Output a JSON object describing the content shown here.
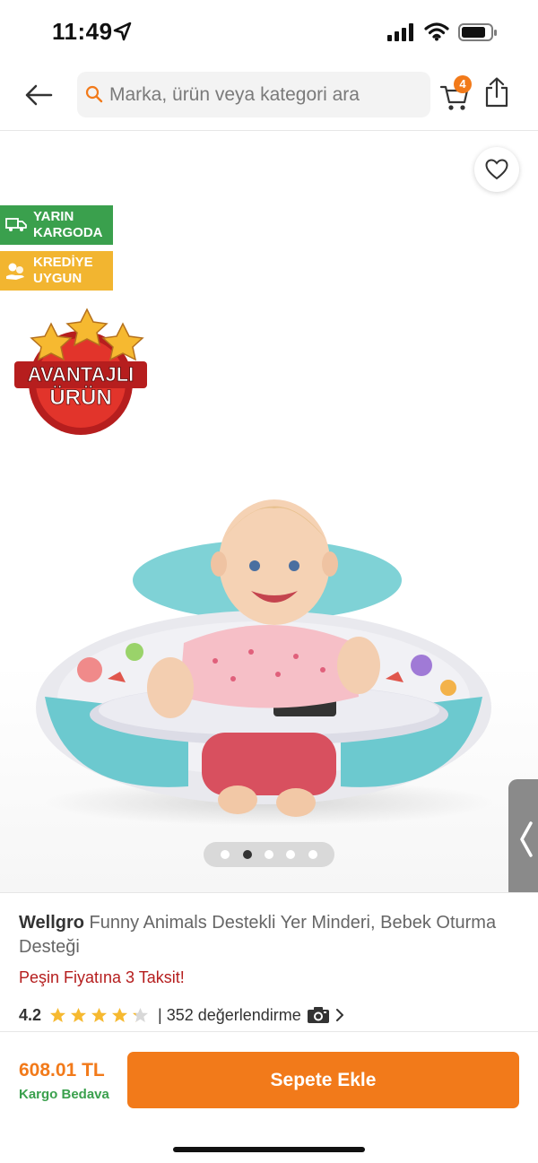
{
  "status_bar": {
    "time": "11:49",
    "icons": [
      "location-arrow-icon",
      "signal-icon",
      "wifi-icon",
      "battery-icon"
    ]
  },
  "header": {
    "back_icon": "arrow-left-icon",
    "search_placeholder": "Marka, ürün veya kategori ara",
    "cart_count": "4",
    "share_icon": "share-icon"
  },
  "product_image": {
    "tags": [
      {
        "label": "YARIN\nKARGODA",
        "icon": "truck-icon",
        "color": "#3aa04d"
      },
      {
        "label": "KREDİYE\nUYGUN",
        "icon": "hand-coins-icon",
        "color": "#f2b530"
      }
    ],
    "advantage_badge": "AVANTAJLI\nÜRÜN",
    "pager_count": 5,
    "pager_active": 2
  },
  "product": {
    "brand": "Wellgro",
    "name": " Funny Animals Destekli Yer Minderi, Bebek Oturma Desteği",
    "installment": "Peşin Fiyatına 3 Taksit!",
    "rating": "4.2",
    "rating_value": 4.2,
    "reviews": "| 352 değerlendirme"
  },
  "purchase": {
    "price": "608.01 TL",
    "shipping": "Kargo Bedava",
    "add_to_cart": "Sepete Ekle"
  },
  "colors": {
    "accent": "#f27a1a",
    "green": "#3aa04d",
    "star": "#f6b930",
    "installment_red": "#b51d1d"
  }
}
